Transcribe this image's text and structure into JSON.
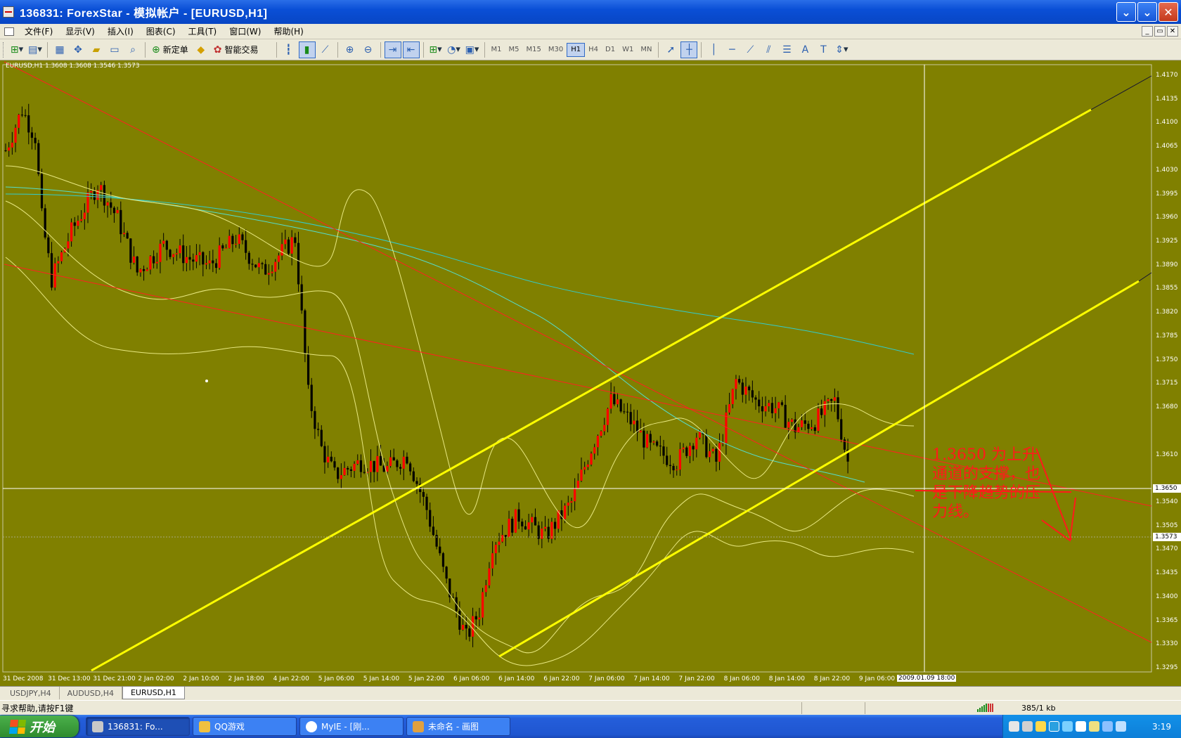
{
  "window": {
    "title": "136831: ForexStar - 模拟帐户 - [EURUSD,H1]",
    "controls": [
      "⌄",
      "⌄",
      "✕"
    ]
  },
  "menu": [
    "文件(F)",
    "显示(V)",
    "插入(I)",
    "图表(C)",
    "工具(T)",
    "窗口(W)",
    "帮助(H)"
  ],
  "mdi_controls": [
    "_",
    "▭",
    "✕"
  ],
  "toolbar": {
    "new_order_label": "新定单",
    "expert_label": "智能交易",
    "timeframes": [
      "M1",
      "M5",
      "M15",
      "M30",
      "H1",
      "H4",
      "D1",
      "W1",
      "MN"
    ],
    "active_timeframe": "H1"
  },
  "chart": {
    "info": "EURUSD,H1  1.3608 1.3608 1.3546 1.3573",
    "background": "#808000",
    "bull_candle": "#ff0000",
    "bear_candle": "#000000",
    "crosshair_price": "1.3650",
    "last_price": "1.3573",
    "crosshair_time": "2009.01.09 18:00",
    "price_levels": [
      "1.4170",
      "1.4135",
      "1.4100",
      "1.4065",
      "1.4030",
      "1.3995",
      "1.3960",
      "1.3925",
      "1.3890",
      "1.3855",
      "1.3820",
      "1.3785",
      "1.3750",
      "1.3715",
      "1.3680",
      "1.3610",
      "1.3540",
      "1.3505",
      "1.3470",
      "1.3435",
      "1.3400",
      "1.3365",
      "1.3330",
      "1.3295"
    ],
    "time_labels": [
      "31 Dec 2008",
      "31 Dec 13:00",
      "31 Dec 21:00",
      "2 Jan 02:00",
      "2 Jan 10:00",
      "2 Jan 18:00",
      "4 Jan 22:00",
      "5 Jan 06:00",
      "5 Jan 14:00",
      "5 Jan 22:00",
      "6 Jan 06:00",
      "6 Jan 14:00",
      "6 Jan 22:00",
      "7 Jan 06:00",
      "7 Jan 14:00",
      "7 Jan 22:00",
      "8 Jan 06:00",
      "8 Jan 14:00",
      "8 Jan 22:00",
      "9 Jan 06:00"
    ],
    "annotation_lines": [
      "1.3650  为上升",
      "通道的支撑，也",
      "是下降趋势的压",
      "力线。"
    ]
  },
  "chart_tabs": [
    "USDJPY,H4",
    "AUDUSD,H4",
    "EURUSD,H1"
  ],
  "active_tab": "EURUSD,H1",
  "status": {
    "help_text": "寻求帮助,请按F1键",
    "traffic": "385/1 kb"
  },
  "taskbar": {
    "start_label": "开始",
    "tasks": [
      {
        "label": "136831: Fo...",
        "active": true
      },
      {
        "label": "QQ游戏",
        "active": false
      },
      {
        "label": "MyIE - [刚...",
        "active": false
      },
      {
        "label": "未命名 - 画图",
        "active": false
      }
    ],
    "clock": "3:19"
  }
}
